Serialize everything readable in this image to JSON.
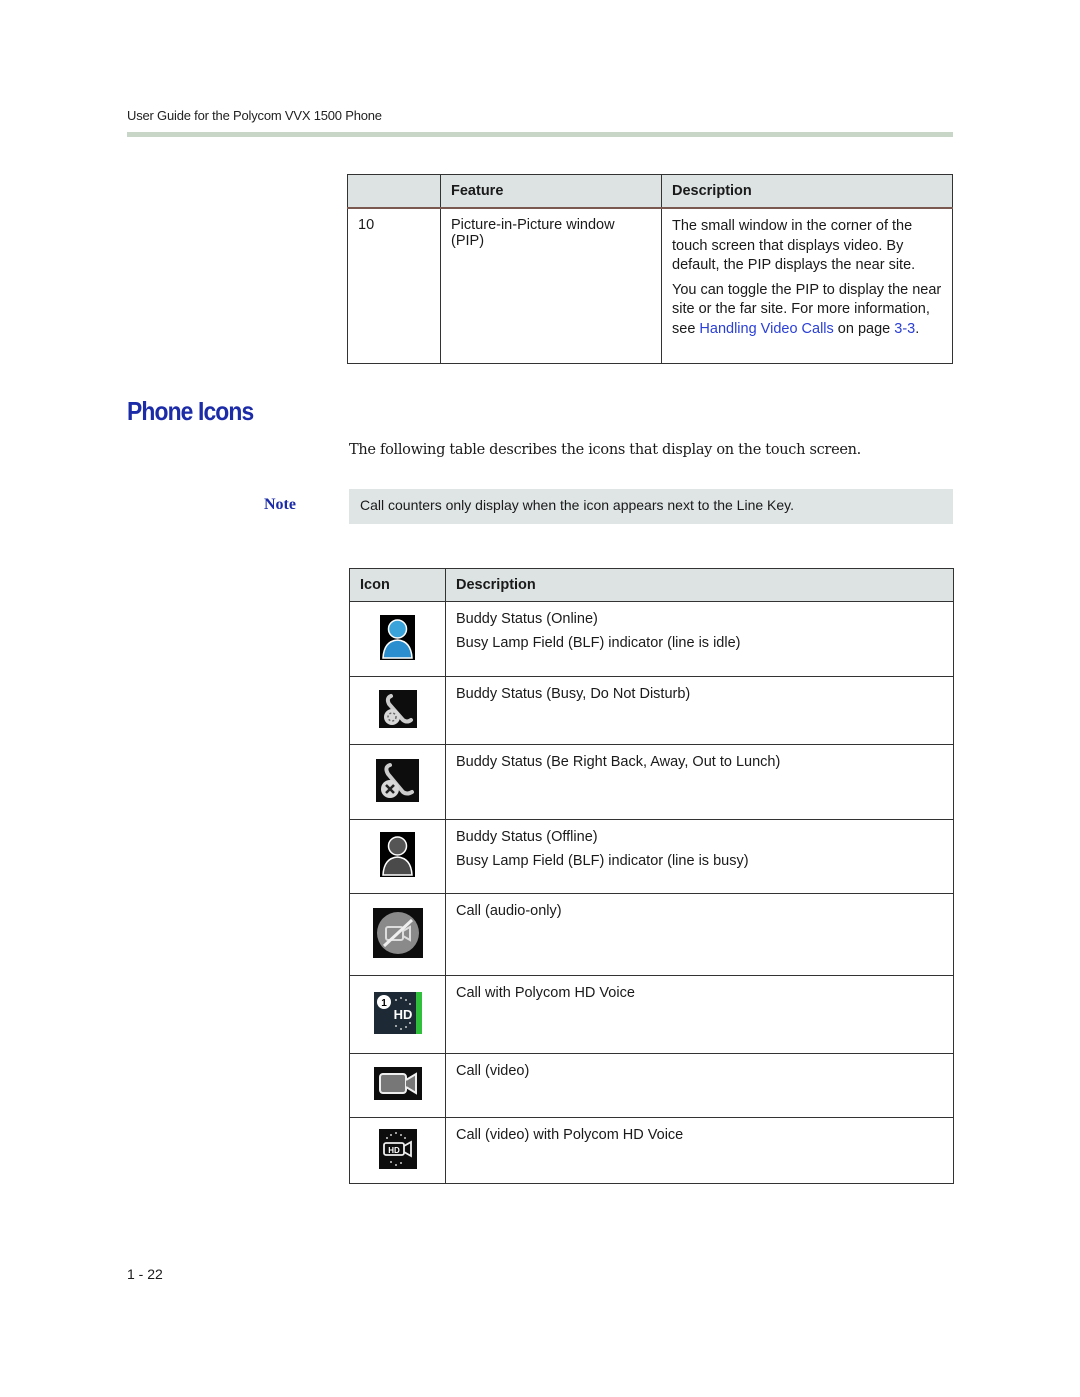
{
  "header": {
    "running_title": "User Guide for the Polycom VVX 1500 Phone"
  },
  "feature_table": {
    "columns": [
      "",
      "Feature",
      "Description"
    ],
    "rows": [
      {
        "number": "10",
        "feature": "Picture-in-Picture window (PIP)",
        "description_p1": "The small window in the corner of the touch screen that displays video. By default, the PIP displays the near site.",
        "description_p2_prefix": "You can toggle the PIP to display the near site or the far site. For more information, see ",
        "description_p2_link": "Handling Video Calls",
        "description_p2_mid": " on page ",
        "description_p2_page_link": "3-3",
        "description_p2_suffix": "."
      }
    ]
  },
  "section": {
    "title": "Phone Icons",
    "intro": "The following table describes the icons that display on the touch screen."
  },
  "note": {
    "label": "Note",
    "text": "Call counters only display when the icon appears next to the Line Key."
  },
  "icons_table": {
    "columns": [
      "Icon",
      "Description"
    ],
    "rows": [
      {
        "icon": "buddy-online-icon",
        "lines": [
          "Buddy Status (Online)",
          "Busy Lamp Field (BLF) indicator (line is idle)"
        ]
      },
      {
        "icon": "buddy-busy-dnd-icon",
        "lines": [
          "Buddy Status (Busy, Do Not Disturb)"
        ]
      },
      {
        "icon": "buddy-away-icon",
        "lines": [
          "Buddy Status (Be Right Back, Away, Out to Lunch)"
        ]
      },
      {
        "icon": "buddy-offline-icon",
        "lines": [
          "Buddy Status (Offline)",
          "Busy Lamp Field (BLF) indicator (line is busy)"
        ]
      },
      {
        "icon": "call-audio-only-icon",
        "lines": [
          "Call (audio-only)"
        ]
      },
      {
        "icon": "call-hd-voice-icon",
        "lines": [
          "Call with Polycom HD Voice"
        ]
      },
      {
        "icon": "call-video-icon",
        "lines": [
          "Call (video)"
        ]
      },
      {
        "icon": "call-video-hd-voice-icon",
        "lines": [
          "Call (video) with Polycom HD Voice"
        ]
      }
    ]
  },
  "footer": {
    "page_number": "1 - 22"
  },
  "colors": {
    "heading_blue": "#1c2ca8",
    "link_blue": "#2a3fd6",
    "table_header_bg": "#dde3e3",
    "note_bg": "#dfe5e5",
    "header_rule": "#c8d6c8"
  }
}
